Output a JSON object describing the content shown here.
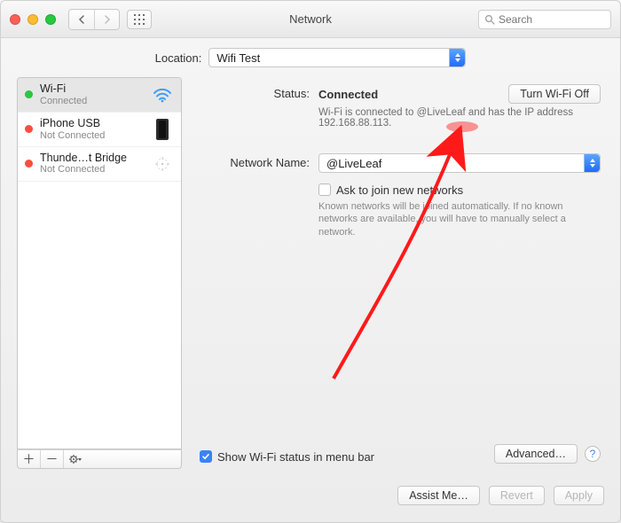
{
  "window": {
    "title": "Network"
  },
  "search": {
    "placeholder": "Search"
  },
  "location": {
    "label": "Location:",
    "value": "Wifi Test"
  },
  "services": [
    {
      "name": "Wi-Fi",
      "status": "Connected",
      "dot": "green",
      "icon": "wifi",
      "selected": true
    },
    {
      "name": "iPhone USB",
      "status": "Not Connected",
      "dot": "red",
      "icon": "phone",
      "selected": false
    },
    {
      "name": "Thunde…t Bridge",
      "status": "Not Connected",
      "dot": "red",
      "icon": "thunderbolt",
      "selected": false
    }
  ],
  "detail": {
    "status_label": "Status:",
    "status_value": "Connected",
    "wifi_off_btn": "Turn Wi-Fi Off",
    "status_desc": "Wi-Fi is connected to @LiveLeaf and has the IP address 192.168.88.113.",
    "network_name_label": "Network Name:",
    "network_name_value": "@LiveLeaf",
    "ask_join_label": "Ask to join new networks",
    "ask_join_help": "Known networks will be joined automatically. If no known networks are available, you will have to manually select a network.",
    "show_menubar_label": "Show Wi-Fi status in menu bar",
    "advanced_btn": "Advanced…"
  },
  "footer": {
    "assist": "Assist Me…",
    "revert": "Revert",
    "apply": "Apply"
  }
}
